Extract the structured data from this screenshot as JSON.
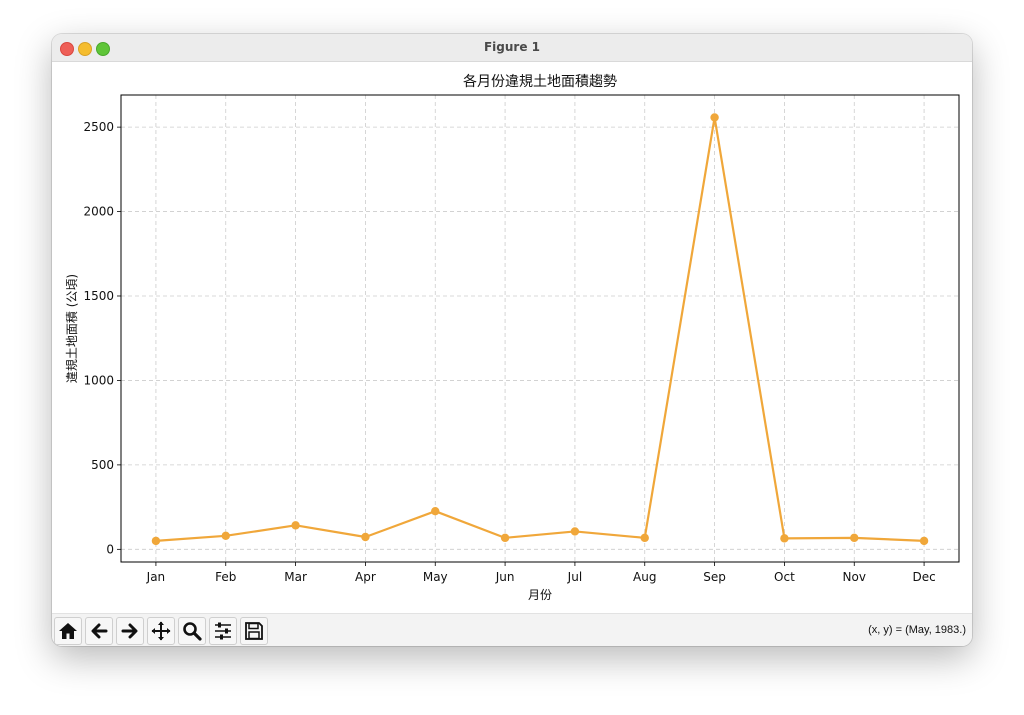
{
  "window": {
    "title": "Figure 1"
  },
  "toolbar": {
    "buttons": [
      {
        "name": "home-icon"
      },
      {
        "name": "back-icon"
      },
      {
        "name": "forward-icon"
      },
      {
        "name": "pan-icon"
      },
      {
        "name": "zoom-icon"
      },
      {
        "name": "configure-subplots-icon"
      },
      {
        "name": "save-icon"
      }
    ],
    "coords": "(x, y) = (May, 1983.)"
  },
  "colors": {
    "line": "#f0a73a",
    "grid": "#cccccc"
  },
  "chart_data": {
    "type": "line",
    "title": "各月份違規土地面積趨勢",
    "xlabel": "月份",
    "ylabel": "違規土地面積 (公頃)",
    "categories": [
      "Jan",
      "Feb",
      "Mar",
      "Apr",
      "May",
      "Jun",
      "Jul",
      "Aug",
      "Sep",
      "Oct",
      "Nov",
      "Dec"
    ],
    "values": [
      50,
      80,
      142,
      73,
      226,
      68,
      106,
      68,
      2557,
      65,
      68,
      50
    ],
    "ylim": [
      -75,
      2690
    ],
    "yticks": [
      0,
      500,
      1000,
      1500,
      2000,
      2500
    ],
    "grid": true,
    "marker": "circle"
  }
}
